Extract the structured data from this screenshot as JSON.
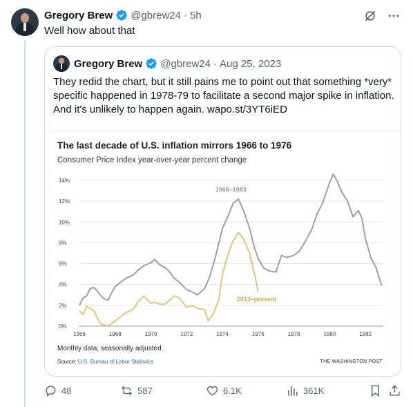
{
  "tweet": {
    "author_name": "Gregory Brew",
    "author_handle": "@gbrew24",
    "time": "5h",
    "text": "Well how about that",
    "dot": "·"
  },
  "quoted": {
    "author_name": "Gregory Brew",
    "author_handle": "@gbrew24",
    "date": "Aug 25, 2023",
    "text": "They redid the chart, but it still pains me to point out that something *very* specific happened in 1978-79 to facilitate a second major spike in inflation. And it's unlikely to happen again. wapo.st/3YT6iED"
  },
  "chart_data": {
    "type": "line",
    "title": "The last decade of U.S. inflation mirrors 1966 to 1976",
    "subtitle": "Consumer Price Index year-over-year percent change",
    "ylabel": "",
    "xlabel": "",
    "ylim": [
      0,
      14
    ],
    "xlim": [
      1966,
      1983
    ],
    "y_ticks": [
      "14%",
      "12%",
      "10%",
      "8%",
      "6%",
      "4%",
      "2%",
      "0%"
    ],
    "x_ticks": [
      "1966",
      "1968",
      "1970",
      "1972",
      "1974",
      "1976",
      "1978",
      "1980",
      "1982"
    ],
    "grid": true,
    "series": [
      {
        "name": "1966–1983",
        "color": "#9e9e9e",
        "x": [
          1966.0,
          1966.2,
          1966.4,
          1966.6,
          1966.8,
          1967.0,
          1967.2,
          1967.4,
          1967.6,
          1967.8,
          1968.0,
          1968.3,
          1968.6,
          1969.0,
          1969.3,
          1969.6,
          1970.0,
          1970.2,
          1970.5,
          1970.8,
          1971.0,
          1971.3,
          1971.6,
          1972.0,
          1972.3,
          1972.6,
          1973.0,
          1973.3,
          1973.6,
          1974.0,
          1974.3,
          1974.6,
          1974.9,
          1975.2,
          1975.5,
          1975.8,
          1976.0,
          1976.3,
          1976.6,
          1977.0,
          1977.3,
          1977.6,
          1978.0,
          1978.3,
          1978.6,
          1979.0,
          1979.3,
          1979.6,
          1980.0,
          1980.2,
          1980.4,
          1980.7,
          1981.0,
          1981.3,
          1981.6,
          1981.8,
          1982.0,
          1982.3,
          1982.6,
          1982.9
        ],
        "values": [
          2.0,
          2.7,
          2.9,
          3.6,
          3.7,
          3.4,
          2.9,
          2.6,
          2.5,
          3.2,
          3.8,
          4.2,
          4.6,
          4.9,
          5.4,
          5.8,
          6.1,
          6.4,
          5.9,
          5.6,
          5.3,
          4.6,
          4.2,
          3.5,
          3.3,
          3.0,
          3.6,
          4.8,
          6.6,
          9.4,
          10.5,
          11.8,
          12.2,
          11.0,
          9.5,
          7.5,
          6.5,
          5.6,
          5.3,
          5.2,
          6.8,
          6.6,
          6.8,
          7.2,
          8.0,
          9.3,
          10.8,
          11.8,
          13.8,
          14.6,
          14.0,
          12.8,
          12.0,
          10.5,
          11.1,
          10.4,
          8.4,
          6.6,
          5.6,
          3.9
        ]
      },
      {
        "name": "2013–present",
        "color": "#e8c27a",
        "x": [
          1966.0,
          1966.2,
          1966.4,
          1966.6,
          1966.8,
          1967.0,
          1967.2,
          1967.4,
          1967.6,
          1967.8,
          1968.0,
          1968.3,
          1968.6,
          1969.0,
          1969.3,
          1969.6,
          1970.0,
          1970.2,
          1970.5,
          1970.8,
          1971.0,
          1971.3,
          1971.6,
          1972.0,
          1972.3,
          1972.6,
          1973.0,
          1973.2,
          1973.5,
          1973.8,
          1974.0,
          1974.3,
          1974.6,
          1974.9,
          1975.2,
          1975.5,
          1975.8,
          1976.0
        ],
        "values": [
          1.5,
          1.1,
          1.9,
          1.7,
          1.5,
          0.8,
          0.2,
          0.1,
          0.0,
          0.3,
          0.5,
          0.9,
          1.3,
          1.6,
          2.4,
          2.9,
          2.2,
          2.3,
          2.1,
          2.1,
          2.4,
          2.9,
          2.7,
          1.8,
          2.0,
          1.7,
          1.6,
          0.5,
          1.2,
          2.6,
          5.0,
          6.8,
          8.2,
          9.0,
          8.3,
          7.1,
          5.0,
          3.3
        ]
      }
    ]
  },
  "chart_text": {
    "note": "Monthly data; seasonally adjusted.",
    "source_prefix": "Source: ",
    "source_link": "U.S. Bureau of Labor Statistics",
    "brand": "THE WASHINGTON POST"
  },
  "actions": {
    "replies": "48",
    "retweets": "587",
    "likes": "6.1K",
    "views": "361K"
  }
}
